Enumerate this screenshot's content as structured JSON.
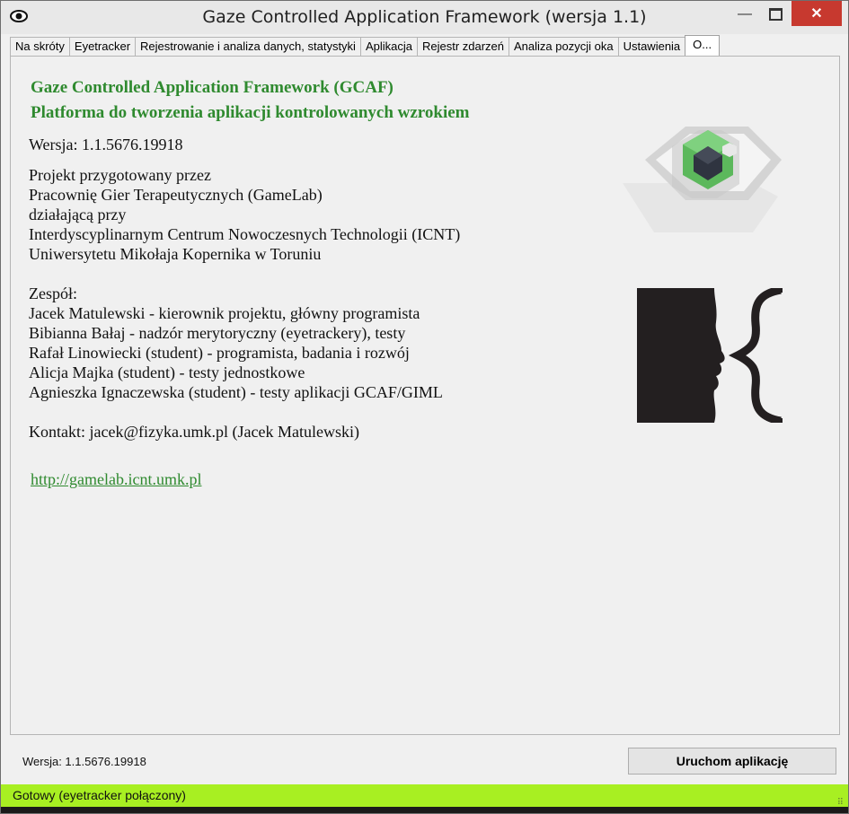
{
  "window": {
    "title": "Gaze Controlled Application Framework (wersja 1.1)"
  },
  "tabs": [
    {
      "label": "Na skróty"
    },
    {
      "label": "Eyetracker"
    },
    {
      "label": "Rejestrowanie i analiza danych, statystyki"
    },
    {
      "label": "Aplikacja"
    },
    {
      "label": "Rejestr zdarzeń"
    },
    {
      "label": "Analiza pozycji oka"
    },
    {
      "label": "Ustawienia"
    },
    {
      "label": "O..."
    }
  ],
  "about": {
    "heading1": "Gaze Controlled Application Framework (GCAF)",
    "heading2": "Platforma do tworzenia aplikacji kontrolowanych wzrokiem",
    "version": "Wersja: 1.1.5676.19918",
    "project_lines": [
      "Projekt przygotowany przez",
      "Pracownię Gier Terapeutycznych (GameLab)",
      "działającą przy",
      "Interdyscyplinarnym Centrum Nowoczesnych Technologii (ICNT)",
      "Uniwersytetu Mikołaja Kopernika w Toruniu"
    ],
    "team_title": "Zespół:",
    "team": [
      "Jacek Matulewski - kierownik projektu, główny programista",
      "Bibianna Bałaj - nadzór merytoryczny (eyetrackery), testy",
      "Rafał Linowiecki (student) - programista, badania i rozwój",
      "Alicja Majka (student) - testy jednostkowe",
      "Agnieszka Ignaczewska (student) - testy aplikacji GCAF/GIML"
    ],
    "contact": "Kontakt: jacek@fizyka.umk.pl (Jacek Matulewski)",
    "link": "http://gamelab.icnt.umk.pl"
  },
  "footer": {
    "version": "Wersja: 1.1.5676.19918",
    "run_button": "Uruchom aplikację"
  },
  "status": {
    "text": "Gotowy (eyetracker połączony)",
    "color": "#a8ef22"
  },
  "colors": {
    "accent_green": "#2f8a2f",
    "close": "#c7392f"
  },
  "icons": {
    "app": "eye-icon",
    "minimize": "minimize-icon",
    "maximize": "maximize-icon",
    "close": "close-icon"
  }
}
